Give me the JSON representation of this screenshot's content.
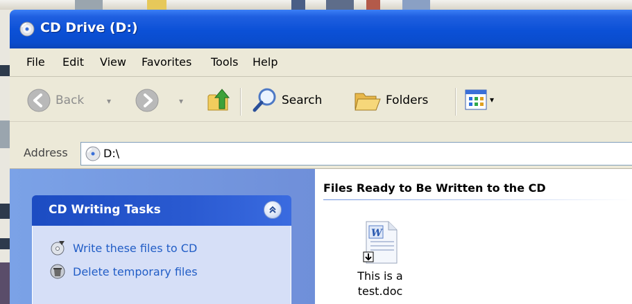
{
  "window": {
    "title": "CD Drive (D:)"
  },
  "menubar": {
    "items": [
      "File",
      "Edit",
      "View",
      "Favorites",
      "Tools",
      "Help"
    ]
  },
  "toolbar": {
    "back_label": "Back",
    "search_label": "Search",
    "folders_label": "Folders"
  },
  "address": {
    "label": "Address",
    "value": "D:\\"
  },
  "taskpane": {
    "title": "CD Writing Tasks",
    "tasks": [
      "Write these files to CD",
      "Delete temporary files"
    ]
  },
  "files": {
    "group_title": "Files Ready to Be Written to the CD",
    "items": [
      {
        "line1": "This is a",
        "line2": "test.doc"
      }
    ]
  },
  "colors": {
    "titlebar": "#0b50d6",
    "task_link": "#215dc6",
    "taskpane_bg": "#7ba2e7"
  }
}
